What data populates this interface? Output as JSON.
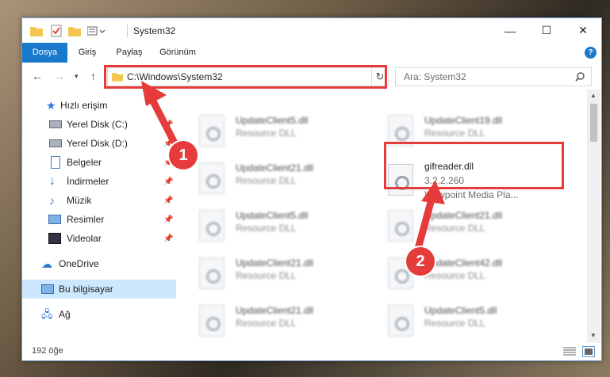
{
  "window": {
    "title": "System32",
    "controls": {
      "minimize": "—",
      "maximize": "☐",
      "close": "✕"
    }
  },
  "ribbon": {
    "tabs": [
      "Dosya",
      "Giriş",
      "Paylaş",
      "Görünüm"
    ],
    "help": "?"
  },
  "address_bar": {
    "path": "C:\\Windows\\System32",
    "search_placeholder": "Ara: System32"
  },
  "nav_pane": {
    "items": [
      {
        "label": "Hızlı erişim",
        "icon": "star-icon"
      },
      {
        "label": "Yerel Disk (C:)",
        "icon": "drive-icon"
      },
      {
        "label": "Yerel Disk (D:)",
        "icon": "drive-icon"
      },
      {
        "label": "Belgeler",
        "icon": "document-icon"
      },
      {
        "label": "İndirmeler",
        "icon": "download-icon"
      },
      {
        "label": "Müzik",
        "icon": "music-icon"
      },
      {
        "label": "Resimler",
        "icon": "pictures-icon"
      },
      {
        "label": "Videolar",
        "icon": "video-icon"
      },
      {
        "label": "OneDrive",
        "icon": "cloud-icon"
      },
      {
        "label": "Bu bilgisayar",
        "icon": "computer-icon"
      },
      {
        "label": "Ağ",
        "icon": "network-icon"
      }
    ]
  },
  "files": {
    "left": [
      {
        "name": "UpdateClient5.dll",
        "desc": "Resource DLL"
      },
      {
        "name": "UpdateClient21.dll",
        "desc": "Resource DLL"
      },
      {
        "name": "UpdateClient5.dll",
        "desc": "Resource DLL"
      },
      {
        "name": "UpdateClient21.dll",
        "desc": "Resource DLL"
      },
      {
        "name": "UpdateClient21.dll",
        "desc": "Resource DLL"
      }
    ],
    "right": [
      {
        "name": "UpdateClient19.dll",
        "desc": "Resource DLL"
      },
      {
        "name": "gifreader.dll",
        "version": "3.2.2.260",
        "desc": "Viewpoint Media Pla..."
      },
      {
        "name": "UpdateClient21.dll",
        "desc": "Resource DLL"
      },
      {
        "name": "UpdateClient42.dll",
        "desc": "Resource DLL"
      },
      {
        "name": "UpdateClient5.dll",
        "desc": "Resource DLL"
      }
    ]
  },
  "status": {
    "count": "192 öğe"
  },
  "annotations": {
    "step1": "1",
    "step2": "2",
    "accent": "#e53b3b"
  }
}
